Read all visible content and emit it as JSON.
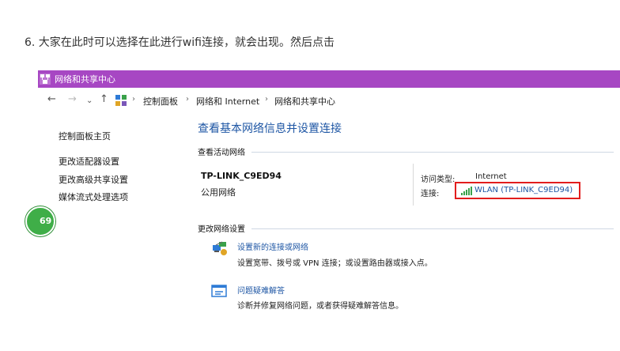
{
  "caption": "6. 大家在此时可以选择在此进行wifi连接，就会出现。然后点击",
  "window": {
    "title": "网络和共享中心",
    "title_color": "#a747c3",
    "title_icon": "network-center-icon"
  },
  "address_bar": {
    "nav_icons": [
      "back-arrow-icon",
      "forward-arrow-icon",
      "chevron-down-icon",
      "up-arrow-icon",
      "control-panel-icon"
    ],
    "breadcrumbs": [
      "控制面板",
      "网络和 Internet",
      "网络和共享中心"
    ]
  },
  "left_nav": {
    "items": [
      "控制面板主页",
      "更改适配器设置",
      "更改高级共享设置",
      "媒体流式处理选项"
    ]
  },
  "main": {
    "title": "查看基本网络信息并设置连接",
    "active_networks_label": "查看活动网络",
    "network_name": "TP-LINK_C9ED94",
    "network_type": "公用网络",
    "access_type_label": "访问类型:",
    "access_type_value": "Internet",
    "connection_label": "连接:",
    "connection_link": "WLAN (TP-LINK_C9ED94)",
    "change_settings_label": "更改网络设置",
    "tasks": [
      {
        "link": "设置新的连接或网络",
        "desc": "设置宽带、拨号或 VPN 连接；或设置路由器或接入点。",
        "icon": "new-connection-icon"
      },
      {
        "link": "问题疑难解答",
        "desc": "诊断并修复网络问题，或者获得疑难解答信息。",
        "icon": "troubleshoot-icon"
      }
    ]
  },
  "badge": "69",
  "colors": {
    "link": "#1e56a4",
    "highlight": "#e21d1d",
    "badge": "#3fae48"
  }
}
